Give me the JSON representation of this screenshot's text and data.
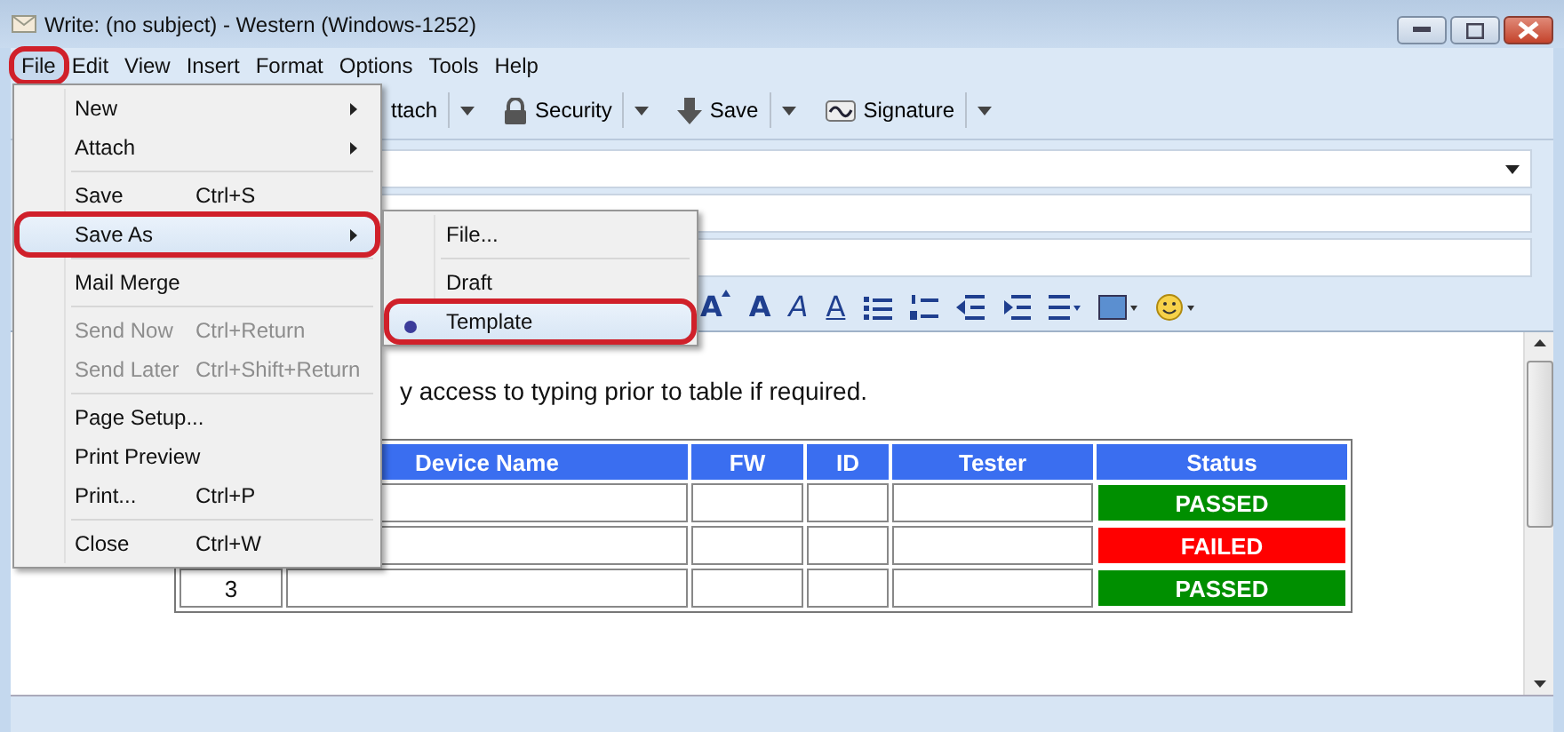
{
  "window": {
    "title": "Write: (no subject) - Western (Windows-1252)"
  },
  "menubar": [
    {
      "label": "File",
      "selected": true,
      "circled": true
    },
    {
      "label": "Edit",
      "selected": false,
      "circled": false
    },
    {
      "label": "View",
      "selected": false,
      "circled": false
    },
    {
      "label": "Insert",
      "selected": false,
      "circled": false
    },
    {
      "label": "Format",
      "selected": false,
      "circled": false
    },
    {
      "label": "Options",
      "selected": false,
      "circled": false
    },
    {
      "label": "Tools",
      "selected": false,
      "circled": false
    },
    {
      "label": "Help",
      "selected": false,
      "circled": false
    }
  ],
  "toolbar": [
    {
      "label": "ttach"
    },
    {
      "label": "Security"
    },
    {
      "label": "Save"
    },
    {
      "label": "Signature"
    }
  ],
  "format_toolbar": [
    {
      "kind": "grow",
      "label": "A"
    },
    {
      "kind": "bold",
      "label": "A"
    },
    {
      "kind": "italic",
      "label": "A"
    },
    {
      "kind": "underline",
      "label": "A"
    },
    {
      "kind": "bullets"
    },
    {
      "kind": "numbers"
    },
    {
      "kind": "outdent"
    },
    {
      "kind": "indent"
    },
    {
      "kind": "align"
    },
    {
      "kind": "color"
    },
    {
      "kind": "smiley"
    }
  ],
  "body_text": "y access to typing prior to table if required.",
  "table": {
    "columns": [
      "Device Name",
      "FW",
      "ID",
      "Tester",
      "Status"
    ],
    "rows": [
      {
        "status": "PASSED",
        "color": "#008f00"
      },
      {
        "status": "FAILED",
        "color": "#ff0000"
      },
      {
        "number": "3",
        "status": "PASSED",
        "color": "#008f00"
      }
    ]
  },
  "file_menu": [
    {
      "kind": "item",
      "label": "New",
      "submenu": true,
      "selected": false,
      "disabled": false
    },
    {
      "kind": "item",
      "label": "Attach",
      "submenu": true,
      "selected": false,
      "disabled": false
    },
    {
      "kind": "separator"
    },
    {
      "kind": "item",
      "label": "Save",
      "shortcut": "Ctrl+S",
      "selected": false,
      "disabled": false
    },
    {
      "kind": "item",
      "label": "Save As",
      "submenu": true,
      "selected": true,
      "disabled": false,
      "circled": true
    },
    {
      "kind": "separator"
    },
    {
      "kind": "item",
      "label": "Mail Merge",
      "selected": false,
      "disabled": false
    },
    {
      "kind": "separator"
    },
    {
      "kind": "item",
      "label": "Send Now",
      "shortcut": "Ctrl+Return",
      "selected": false,
      "disabled": true
    },
    {
      "kind": "item",
      "label": "Send Later",
      "shortcut": "Ctrl+Shift+Return",
      "selected": false,
      "disabled": true
    },
    {
      "kind": "separator"
    },
    {
      "kind": "item",
      "label": "Page Setup...",
      "selected": false,
      "disabled": false
    },
    {
      "kind": "item",
      "label": "Print Preview",
      "selected": false,
      "disabled": false
    },
    {
      "kind": "item",
      "label": "Print...",
      "shortcut": "Ctrl+P",
      "selected": false,
      "disabled": false
    },
    {
      "kind": "separator"
    },
    {
      "kind": "item",
      "label": "Close",
      "shortcut": "Ctrl+W",
      "selected": false,
      "disabled": false
    }
  ],
  "save_as_menu": [
    {
      "kind": "item",
      "label": "File...",
      "selected": false
    },
    {
      "kind": "separator"
    },
    {
      "kind": "radio",
      "label": "Draft",
      "selected": false,
      "checked": false
    },
    {
      "kind": "radio",
      "label": "Template",
      "selected": true,
      "checked": true,
      "circled": true
    }
  ]
}
